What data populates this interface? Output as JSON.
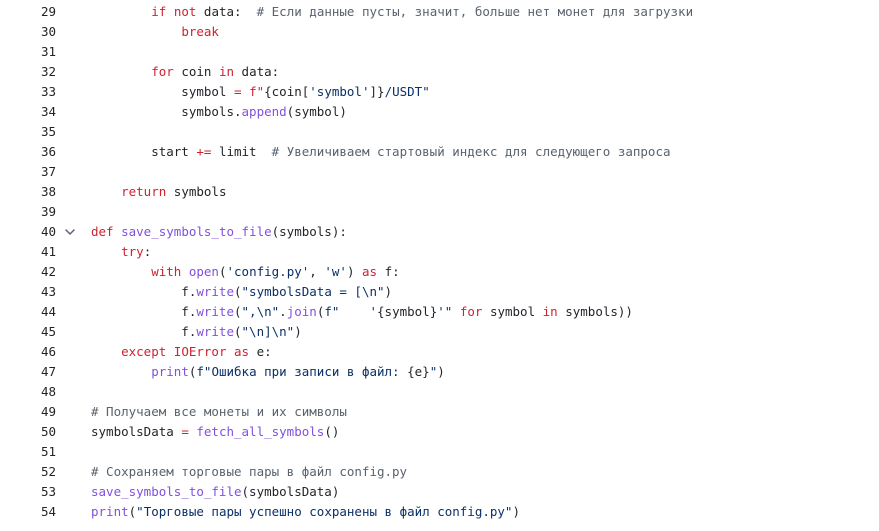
{
  "editor": {
    "colors": {
      "keyword": "#cf222e",
      "function": "#8250df",
      "string": "#0a3069",
      "comment": "#59636e",
      "text": "#1f2328"
    },
    "fold_icon": "chevron-down-icon",
    "lines": [
      {
        "number": "29",
        "tokens": [
          {
            "t": "        "
          },
          {
            "t": "if",
            "c": "k"
          },
          {
            "t": " "
          },
          {
            "t": "not",
            "c": "k"
          },
          {
            "t": " data:  "
          },
          {
            "t": "# Если данные пусты, значит, больше нет монет для загрузки",
            "c": "c"
          }
        ]
      },
      {
        "number": "30",
        "tokens": [
          {
            "t": "            "
          },
          {
            "t": "break",
            "c": "k"
          }
        ]
      },
      {
        "number": "31",
        "tokens": []
      },
      {
        "number": "32",
        "tokens": [
          {
            "t": "        "
          },
          {
            "t": "for",
            "c": "k"
          },
          {
            "t": " coin "
          },
          {
            "t": "in",
            "c": "k"
          },
          {
            "t": " data:"
          }
        ]
      },
      {
        "number": "33",
        "tokens": [
          {
            "t": "            symbol "
          },
          {
            "t": "=",
            "c": "k"
          },
          {
            "t": " "
          },
          {
            "t": "f\"",
            "c": "k"
          },
          {
            "t": "{coin["
          },
          {
            "t": "'symbol'",
            "c": "s"
          },
          {
            "t": "]}"
          },
          {
            "t": "/USDT\"",
            "c": "s"
          }
        ]
      },
      {
        "number": "34",
        "tokens": [
          {
            "t": "            symbols."
          },
          {
            "t": "append",
            "c": "f"
          },
          {
            "t": "(symbol)"
          }
        ]
      },
      {
        "number": "35",
        "tokens": []
      },
      {
        "number": "36",
        "tokens": [
          {
            "t": "        start "
          },
          {
            "t": "+=",
            "c": "k"
          },
          {
            "t": " limit  "
          },
          {
            "t": "# Увеличиваем стартовый индекс для следующего запроса",
            "c": "c"
          }
        ]
      },
      {
        "number": "37",
        "tokens": []
      },
      {
        "number": "38",
        "tokens": [
          {
            "t": "    "
          },
          {
            "t": "return",
            "c": "k"
          },
          {
            "t": " symbols"
          }
        ]
      },
      {
        "number": "39",
        "tokens": []
      },
      {
        "number": "40",
        "fold": true,
        "tokens": [
          {
            "t": "def",
            "c": "k"
          },
          {
            "t": " "
          },
          {
            "t": "save_symbols_to_file",
            "c": "f"
          },
          {
            "t": "(symbols):"
          }
        ]
      },
      {
        "number": "41",
        "tokens": [
          {
            "t": "    "
          },
          {
            "t": "try",
            "c": "k"
          },
          {
            "t": ":"
          }
        ]
      },
      {
        "number": "42",
        "tokens": [
          {
            "t": "        "
          },
          {
            "t": "with",
            "c": "k"
          },
          {
            "t": " "
          },
          {
            "t": "open",
            "c": "f"
          },
          {
            "t": "("
          },
          {
            "t": "'config.py'",
            "c": "s"
          },
          {
            "t": ", "
          },
          {
            "t": "'w'",
            "c": "s"
          },
          {
            "t": ") "
          },
          {
            "t": "as",
            "c": "k"
          },
          {
            "t": " f:"
          }
        ]
      },
      {
        "number": "43",
        "tokens": [
          {
            "t": "            f."
          },
          {
            "t": "write",
            "c": "f"
          },
          {
            "t": "("
          },
          {
            "t": "\"symbolsData = [\\n\"",
            "c": "s"
          },
          {
            "t": ")"
          }
        ]
      },
      {
        "number": "44",
        "tokens": [
          {
            "t": "            f."
          },
          {
            "t": "write",
            "c": "f"
          },
          {
            "t": "("
          },
          {
            "t": "\",\\n\"",
            "c": "s"
          },
          {
            "t": "."
          },
          {
            "t": "join",
            "c": "f"
          },
          {
            "t": "("
          },
          {
            "t": "f\"    '",
            "c": "s"
          },
          {
            "t": "{symbol}"
          },
          {
            "t": "'\"",
            "c": "s"
          },
          {
            "t": " "
          },
          {
            "t": "for",
            "c": "k"
          },
          {
            "t": " symbol "
          },
          {
            "t": "in",
            "c": "k"
          },
          {
            "t": " symbols))"
          }
        ]
      },
      {
        "number": "45",
        "tokens": [
          {
            "t": "            f."
          },
          {
            "t": "write",
            "c": "f"
          },
          {
            "t": "("
          },
          {
            "t": "\"\\n]\\n\"",
            "c": "s"
          },
          {
            "t": ")"
          }
        ]
      },
      {
        "number": "46",
        "tokens": [
          {
            "t": "    "
          },
          {
            "t": "except",
            "c": "k"
          },
          {
            "t": " "
          },
          {
            "t": "IOError",
            "c": "k"
          },
          {
            "t": " "
          },
          {
            "t": "as",
            "c": "k"
          },
          {
            "t": " e:"
          }
        ]
      },
      {
        "number": "47",
        "tokens": [
          {
            "t": "        "
          },
          {
            "t": "print",
            "c": "f"
          },
          {
            "t": "("
          },
          {
            "t": "f\"Ошибка при записи в файл: ",
            "c": "s"
          },
          {
            "t": "{e}"
          },
          {
            "t": "\"",
            "c": "s"
          },
          {
            "t": ")"
          }
        ]
      },
      {
        "number": "48",
        "tokens": []
      },
      {
        "number": "49",
        "tokens": [
          {
            "t": "# Получаем все монеты и их символы",
            "c": "c"
          }
        ]
      },
      {
        "number": "50",
        "tokens": [
          {
            "t": "symbolsData "
          },
          {
            "t": "=",
            "c": "k"
          },
          {
            "t": " "
          },
          {
            "t": "fetch_all_symbols",
            "c": "f"
          },
          {
            "t": "()"
          }
        ]
      },
      {
        "number": "51",
        "tokens": []
      },
      {
        "number": "52",
        "tokens": [
          {
            "t": "# Сохраняем торговые пары в файл config.py",
            "c": "c"
          }
        ]
      },
      {
        "number": "53",
        "tokens": [
          {
            "t": "save_symbols_to_file",
            "c": "f"
          },
          {
            "t": "(symbolsData)"
          }
        ]
      },
      {
        "number": "54",
        "tokens": [
          {
            "t": "print",
            "c": "f"
          },
          {
            "t": "("
          },
          {
            "t": "\"Торговые пары успешно сохранены в файл config.py\"",
            "c": "s"
          },
          {
            "t": ")"
          }
        ]
      }
    ]
  }
}
